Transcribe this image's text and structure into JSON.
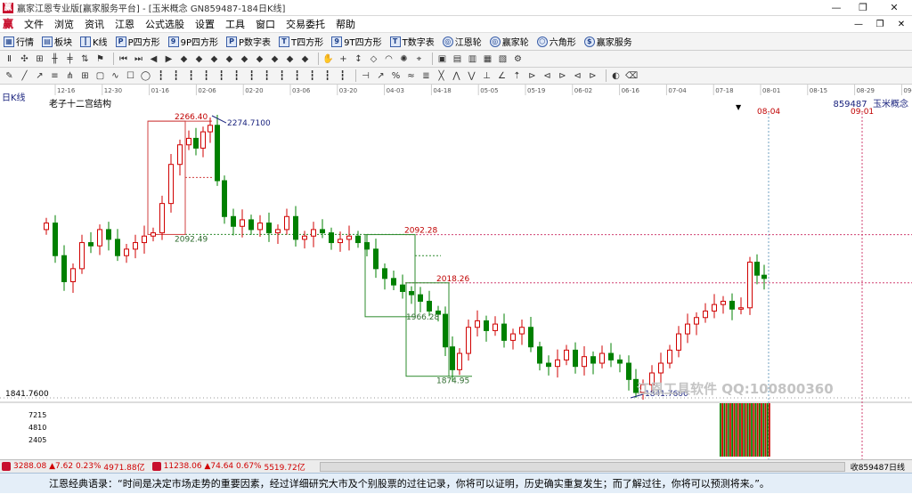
{
  "window": {
    "title": "赢家江恩专业版[赢家服务平台] - [玉米概念  GN859487-184日K线]",
    "controls": [
      "—",
      "❐",
      "✕"
    ]
  },
  "menu": {
    "items": [
      "文件",
      "浏览",
      "资讯",
      "江恩",
      "公式选股",
      "设置",
      "工具",
      "窗口",
      "交易委托",
      "帮助"
    ],
    "right": [
      "—",
      "❐",
      "✕"
    ]
  },
  "toolbar": {
    "items": [
      {
        "label": "行情",
        "icon": "grid-icon"
      },
      {
        "label": "板块",
        "icon": "blocks-icon"
      },
      {
        "label": "K线",
        "icon": "candle-icon"
      },
      {
        "label": "P四方形",
        "icon": "p-square-icon"
      },
      {
        "label": "9P四方形",
        "icon": "9p-square-icon"
      },
      {
        "label": "P数字表",
        "icon": "p-table-icon"
      },
      {
        "label": "T四方形",
        "icon": "t-square-icon"
      },
      {
        "label": "9T四方形",
        "icon": "9t-square-icon"
      },
      {
        "label": "T数字表",
        "icon": "t-table-icon"
      },
      {
        "label": "江恩轮",
        "icon": "gann-wheel-icon"
      },
      {
        "label": "赢家轮",
        "icon": "winner-wheel-icon"
      },
      {
        "label": "六角形",
        "icon": "hexagon-icon"
      },
      {
        "label": "赢家服务",
        "icon": "dollar-icon"
      }
    ]
  },
  "chart": {
    "period_label": "日K线",
    "indicator_name": "老子十二宫结构",
    "code": "859487",
    "name": "玉米概念",
    "date_axis": [
      "12-16",
      "12-30",
      "01-16",
      "02-06",
      "02-20",
      "03-06",
      "03-20",
      "04-03",
      "04-18",
      "05-05",
      "05-19",
      "06-02",
      "06-16",
      "07-04",
      "07-18",
      "08-01",
      "08-15",
      "08-29",
      "09-12"
    ],
    "annotations": {
      "high": "2274.7100",
      "low": "1841.7600",
      "level_2266": "2266.40",
      "level_2092a": "2092.49",
      "level_2092b": "2092.28",
      "level_2018": "2018.26",
      "level_1966": "1966.28",
      "level_1874": "1874.95",
      "date_0804": "08-04",
      "date_0901": "09-01"
    },
    "price_axis_low": "1841.7600",
    "volume_axis": [
      "7215",
      "4810",
      "2405"
    ],
    "colors": {
      "up": "#d00000",
      "down": "#008000",
      "box": "#d04040",
      "boxgreen": "#2e8b2e",
      "guide": "#d04070"
    }
  },
  "chart_data": {
    "type": "candlestick",
    "ylim": [
      1841.76,
      2274.71
    ],
    "x": [
      "12-16",
      "12-30",
      "01-16",
      "02-06",
      "02-20",
      "03-06",
      "03-20",
      "04-03",
      "04-18",
      "05-05",
      "05-19",
      "06-02",
      "06-16",
      "07-04",
      "07-18",
      "08-01",
      "08-15",
      "08-29",
      "09-12"
    ]
  },
  "status": {
    "index1": {
      "value": "3288.08",
      "change": "▲7.62",
      "pct": "0.23%",
      "amount": "4971.88亿"
    },
    "index2": {
      "value": "11238.06",
      "change": "▲74.64",
      "pct": "0.67%",
      "amount": "5519.72亿"
    },
    "right_text": "收859487日线"
  },
  "quote": "江恩经典语录：“时间是决定市场走势的重要因素，经过详细研究大市及个别股票的过往记录，你将可以证明，历史确实重复发生；而了解过往，你将可以预测将来。”。",
  "watermark": "江恩工具软件  QQ:100800360"
}
